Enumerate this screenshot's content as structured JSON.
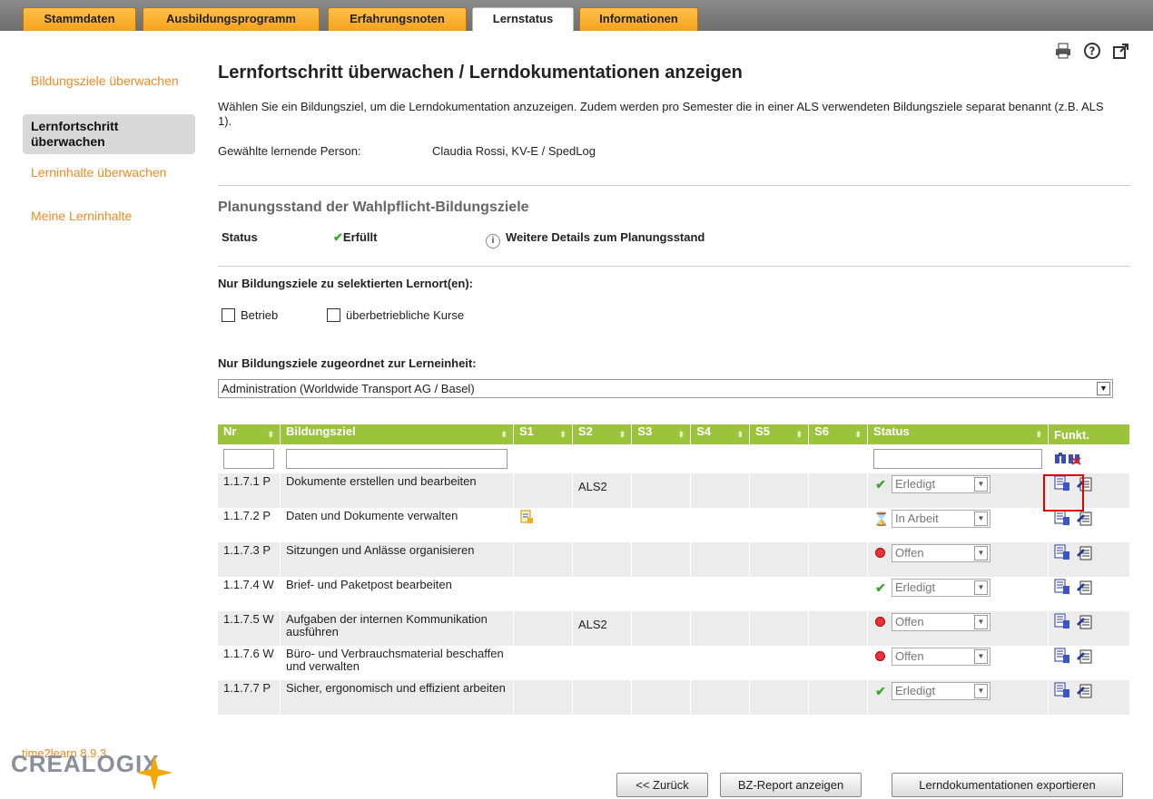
{
  "tabs": [
    {
      "label": "Stammdaten"
    },
    {
      "label": "Ausbildungsprogramm"
    },
    {
      "label": "Erfahrungsnoten"
    },
    {
      "label": "Lernstatus"
    },
    {
      "label": "Informationen"
    }
  ],
  "sidebar": {
    "items": [
      {
        "label": "Bildungsziele überwachen"
      },
      {
        "label": "Lernfortschritt überwachen"
      },
      {
        "label": "Lerninhalte überwachen"
      },
      {
        "label": "Meine Lerninhalte"
      }
    ],
    "version": "time2learn 8.9.3",
    "logo": "CREALOGIX"
  },
  "page": {
    "title": "Lernfortschritt überwachen / Lerndokumentationen anzeigen",
    "intro": "Wählen Sie ein Bildungsziel, um die Lerndokumentation anzuzeigen. Zudem werden pro Semester die in einer ALS verwendeten Bildungsziele separat benannt (z.B. ALS 1).",
    "person_label": "Gewählte lernende Person:",
    "person_value": "Claudia Rossi, KV-E / SpedLog"
  },
  "planning": {
    "title": "Planungsstand der Wahlpflicht-Bildungsziele",
    "status_label": "Status",
    "status_value": "Erfüllt",
    "details_link": "Weitere Details zum Planungsstand"
  },
  "filters": {
    "lernort_label": "Nur Bildungsziele zu selektierten Lernort(en):",
    "checkbox_betrieb": "Betrieb",
    "checkbox_uek": "überbetriebliche Kurse",
    "lerneinheit_label": "Nur Bildungsziele zugeordnet zur Lerneinheit:",
    "lerneinheit_value": "Administration (Worldwide Transport AG / Basel)"
  },
  "table": {
    "headers": {
      "nr": "Nr",
      "ziel": "Bildungsziel",
      "s1": "S1",
      "s2": "S2",
      "s3": "S3",
      "s4": "S4",
      "s5": "S5",
      "s6": "S6",
      "status": "Status",
      "funkt": "Funkt."
    },
    "rows": [
      {
        "nr": "1.1.7.1 P",
        "ziel": "Dokumente erstellen und bearbeiten",
        "s2": "ALS2",
        "status": "Erledigt"
      },
      {
        "nr": "1.1.7.2 P",
        "ziel": "Daten und Dokumente verwalten",
        "s2": "",
        "status": "In Arbeit"
      },
      {
        "nr": "1.1.7.3 P",
        "ziel": "Sitzungen und Anlässe organisieren",
        "s2": "",
        "status": "Offen"
      },
      {
        "nr": "1.1.7.4 W",
        "ziel": "Brief- und Paketpost bearbeiten",
        "s2": "",
        "status": "Erledigt"
      },
      {
        "nr": "1.1.7.5 W",
        "ziel": "Aufgaben der internen Kommunikation ausführen",
        "s2": "ALS2",
        "status": "Offen"
      },
      {
        "nr": "1.1.7.6 W",
        "ziel": "Büro- und Verbrauchsmaterial beschaffen und verwalten",
        "s2": "",
        "status": "Offen"
      },
      {
        "nr": "1.1.7.7 P",
        "ziel": "Sicher, ergonomisch und effizient arbeiten",
        "s2": "",
        "status": "Erledigt"
      }
    ]
  },
  "buttons": {
    "back": "<< Zurück",
    "report": "BZ-Report anzeigen",
    "export": "Lerndokumentationen exportieren"
  }
}
